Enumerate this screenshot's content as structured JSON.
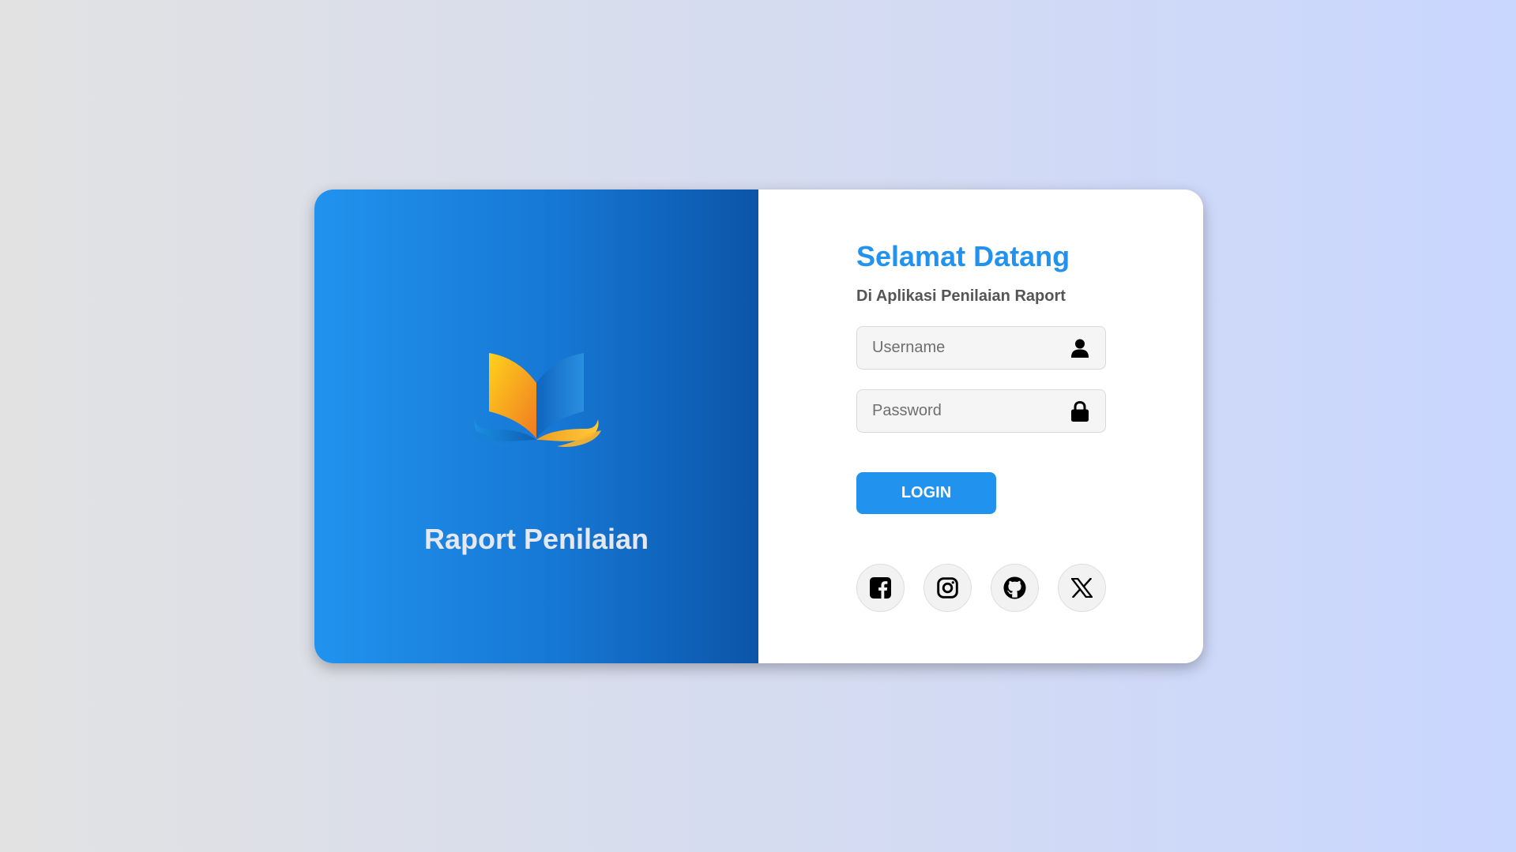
{
  "brand": {
    "title": "Raport Penilaian",
    "logo_icon": "open-book-icon"
  },
  "login": {
    "heading": "Selamat Datang",
    "subheading": "Di Aplikasi Penilaian Raport",
    "username": {
      "placeholder": "Username",
      "value": "",
      "icon": "user-icon"
    },
    "password": {
      "placeholder": "Password",
      "value": "",
      "icon": "lock-icon"
    },
    "login_label": "LOGIN"
  },
  "socials": [
    {
      "name": "facebook",
      "icon": "facebook-icon"
    },
    {
      "name": "instagram",
      "icon": "instagram-icon"
    },
    {
      "name": "github",
      "icon": "github-icon"
    },
    {
      "name": "x",
      "icon": "x-icon"
    }
  ],
  "colors": {
    "accent": "#2193ee",
    "panel_dark": "#0b55a8",
    "background_left": "#e2e2e2",
    "background_right": "#c9d6fe"
  }
}
